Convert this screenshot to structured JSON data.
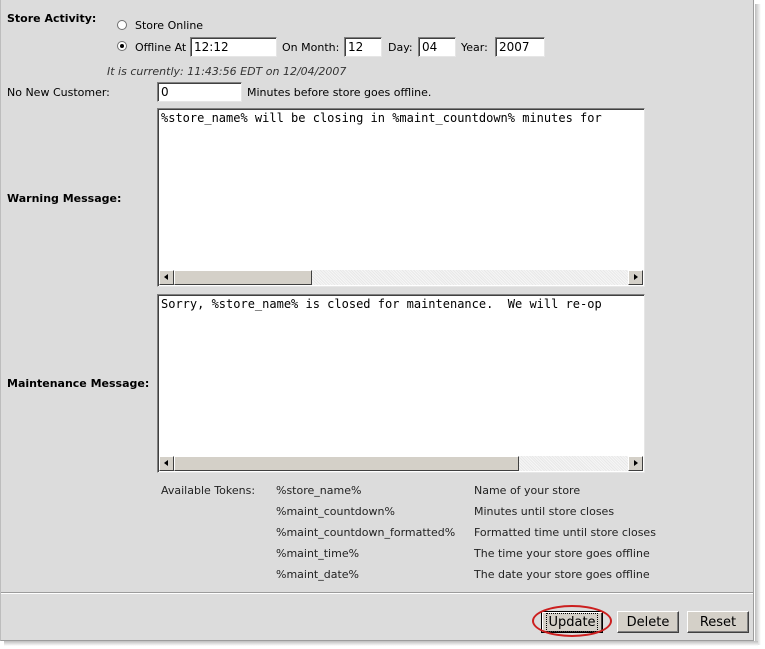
{
  "store_activity": {
    "label": "Store Activity:",
    "option_online": "Store Online",
    "option_offline": "Offline At",
    "offline_time": "12:12",
    "on_month_label": "On Month:",
    "month": "12",
    "day_label": "Day:",
    "day": "04",
    "year_label": "Year:",
    "year": "2007",
    "current_time_text": "It is currently: 11:43:56 EDT on 12/04/2007"
  },
  "no_new_customer": {
    "label": "No New Customer:",
    "value": "0",
    "suffix": "Minutes before store goes offline."
  },
  "warning_message": {
    "label": "Warning Message:",
    "text": "%store_name% will be closing in %maint_countdown% minutes for"
  },
  "maintenance_message": {
    "label": "Maintenance Message:",
    "text": "Sorry, %store_name% is closed for maintenance.  We will re-op"
  },
  "tokens": {
    "label": "Available Tokens:",
    "items": [
      {
        "token": "%store_name%",
        "desc": "Name of your store"
      },
      {
        "token": "%maint_countdown%",
        "desc": "Minutes until store closes"
      },
      {
        "token": "%maint_countdown_formatted%",
        "desc": "Formatted time until store closes"
      },
      {
        "token": "%maint_time%",
        "desc": "The time your store goes offline"
      },
      {
        "token": "%maint_date%",
        "desc": "The date your store goes offline"
      }
    ]
  },
  "buttons": {
    "update": "Update",
    "delete": "Delete",
    "reset": "Reset"
  },
  "colors": {
    "panel_bg": "#dcdcdc",
    "highlight_circle": "#cc1f1f"
  }
}
